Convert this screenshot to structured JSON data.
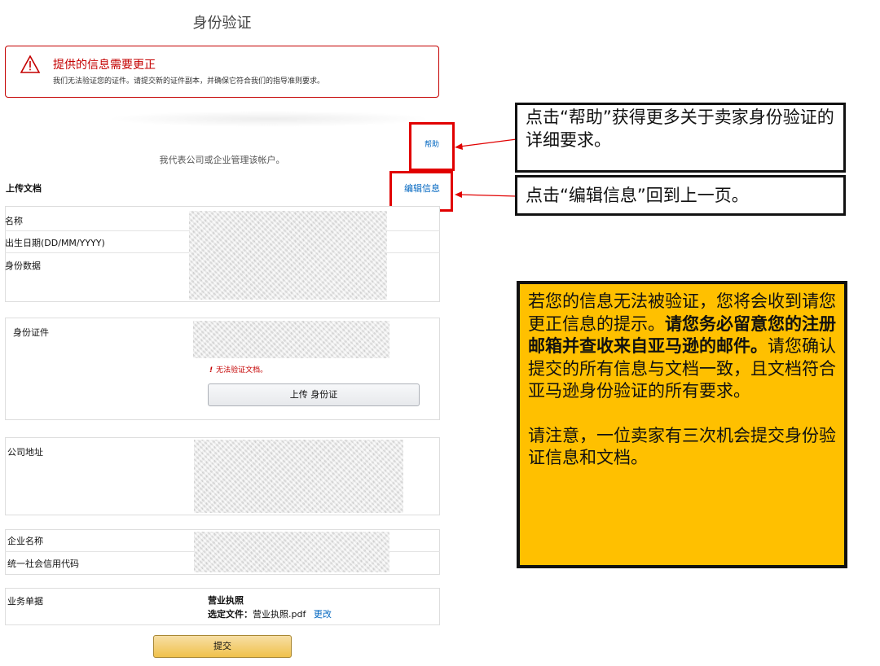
{
  "page_title": "身份验证",
  "alert": {
    "title": "提供的信息需要更正",
    "message": "我们无法验证您的证件。请提交新的证件副本，并确保它符合我们的指导准则要求。",
    "icon": "warning-icon",
    "color": "#c40000"
  },
  "links": {
    "help": "帮助",
    "edit_info": "编辑信息"
  },
  "representation_text": "我代表公司或企业管理该帐户。",
  "upload_heading": "上传文档",
  "personal_fields": [
    "名称",
    "出生日期(DD/MM/YYYY)",
    "身份数据"
  ],
  "id_section": {
    "label": "身份证件",
    "error_icon": "!",
    "error_text": "无法验证文档。",
    "upload_button": "上传 身份证"
  },
  "company_address_label": "公司地址",
  "business_fields": [
    "企业名称",
    "统一社会信用代码"
  ],
  "business_doc": {
    "label": "业务单据",
    "doc_name": "营业执照",
    "file_prefix": "选定文件：",
    "file_name": "营业执照.pdf",
    "change_link": "更改"
  },
  "submit_button": "提交",
  "callouts": {
    "help_note": "点击“帮助”获得更多关于卖家身份验证的详细要求。",
    "edit_note": "点击“编辑信息”回到上一页。"
  },
  "note": {
    "p1_a": "若您的信息无法被验证，您将会收到请您更正信息的提示。",
    "p1_bold": "请您务必留意您的注册邮箱并查收来自亚马逊的邮件。",
    "p1_b": "请您确认提交的所有信息与文档一致，且文档符合亚马逊身份验证的所有要求。",
    "p2": "请注意，一位卖家有三次机会提交身份验证信息和文档。"
  },
  "colors": {
    "link": "#0066c0",
    "annotation_red": "#e10000",
    "note_background": "#ffc000",
    "submit_button": "#f0c14b"
  }
}
